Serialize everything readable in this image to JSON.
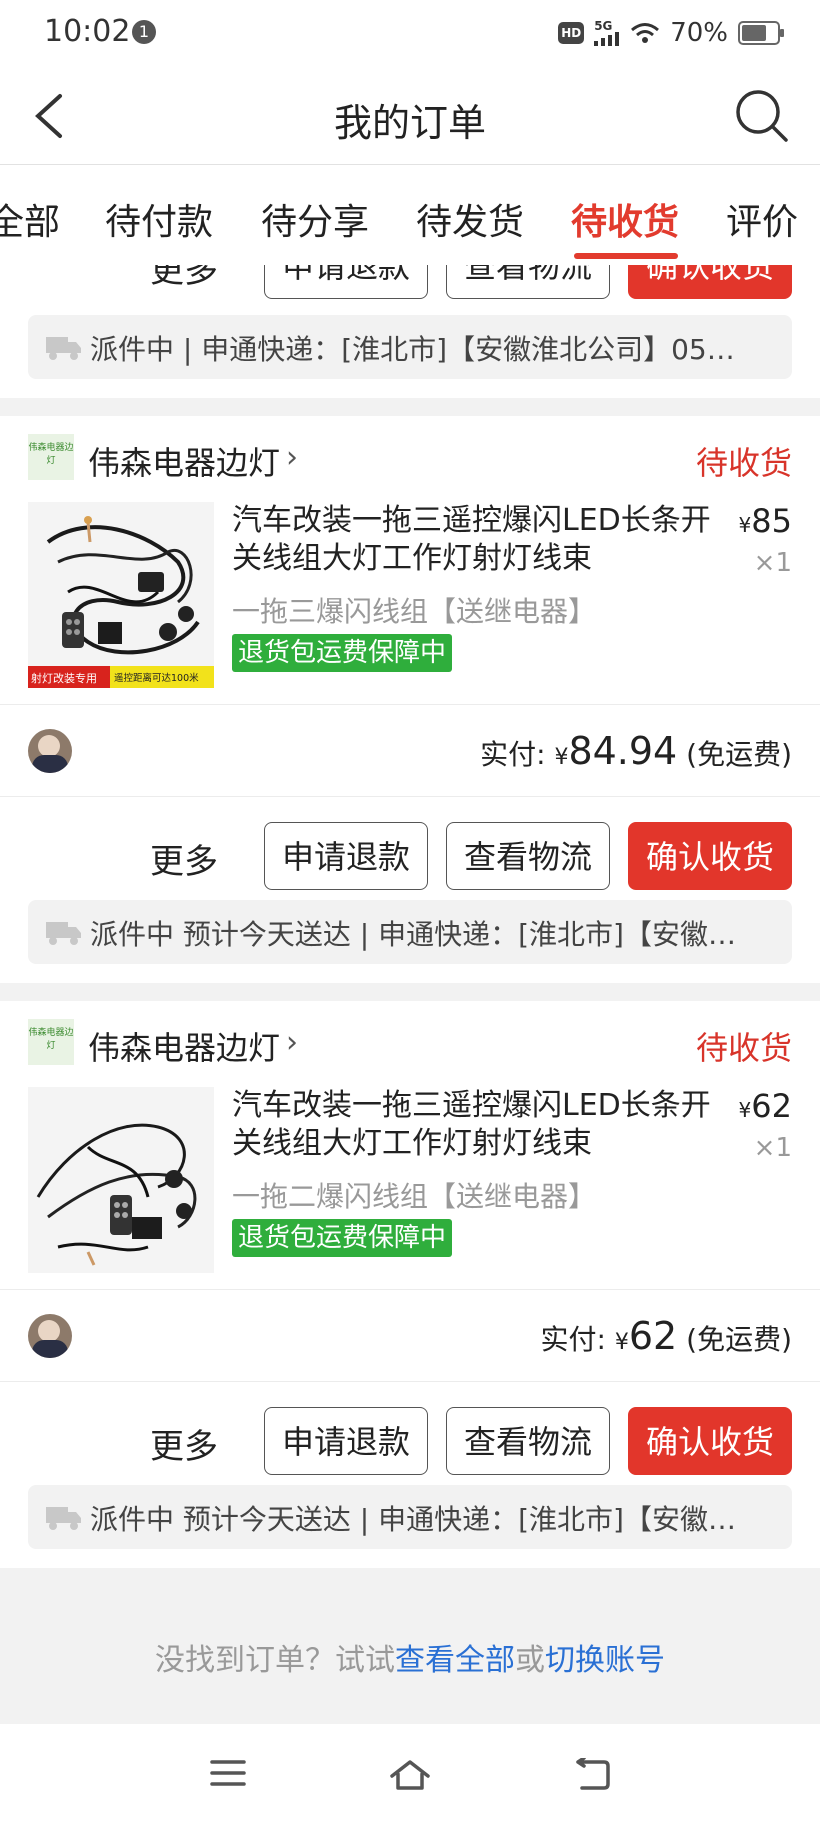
{
  "status_bar": {
    "time": "10:02",
    "notification_count": "1",
    "hd": "HD",
    "network": "5G",
    "battery": "70%"
  },
  "header": {
    "title": "我的订单"
  },
  "tabs": [
    "全部",
    "待付款",
    "待分享",
    "待发货",
    "待收货",
    "评价"
  ],
  "active_tab": "待收货",
  "partial_card": {
    "actions": {
      "more": "更多",
      "refund": "申请退款",
      "logistics": "查看物流",
      "confirm": "确认收货"
    },
    "logistics": "派件中 | 申通快递：[淮北市]【安徽淮北公司】05…"
  },
  "orders": [
    {
      "shop": {
        "logo_text": "伟森电器边灯",
        "name": "伟森电器边灯"
      },
      "status": "待收货",
      "product": {
        "title": "汽车改装一拖三遥控爆闪LED长条开关线组大灯工作灯射灯线束",
        "price_symbol": "¥",
        "price": "85",
        "qty": "×1",
        "sku": "一拖三爆闪线组【送继电器】",
        "badge": "退货包运费保障中",
        "image_caption_left": "射灯改装专用",
        "image_caption_right": "遥控距离可达100米"
      },
      "payment": {
        "label": "实付:",
        "symbol": "¥",
        "amount": "84.94",
        "note": "(免运费)"
      },
      "actions": {
        "more": "更多",
        "refund": "申请退款",
        "logistics": "查看物流",
        "confirm": "确认收货"
      },
      "logistics": "派件中 预计今天送达 | 申通快递：[淮北市]【安徽…"
    },
    {
      "shop": {
        "logo_text": "伟森电器边灯",
        "name": "伟森电器边灯"
      },
      "status": "待收货",
      "product": {
        "title": "汽车改装一拖三遥控爆闪LED长条开关线组大灯工作灯射灯线束",
        "price_symbol": "¥",
        "price": "62",
        "qty": "×1",
        "sku": "一拖二爆闪线组【送继电器】",
        "badge": "退货包运费保障中"
      },
      "payment": {
        "label": "实付:",
        "symbol": "¥",
        "amount": "62",
        "note": "(免运费)"
      },
      "actions": {
        "more": "更多",
        "refund": "申请退款",
        "logistics": "查看物流",
        "confirm": "确认收货"
      },
      "logistics": "派件中 预计今天送达 | 申通快递：[淮北市]【安徽…"
    }
  ],
  "empty_tip": {
    "prefix": "没找到订单？试试",
    "link1": "查看全部",
    "middle": "或",
    "link2": "切换账号"
  },
  "colors": {
    "accent": "#e23b2e",
    "badge_green": "#2fae3c",
    "link_blue": "#2a70d4"
  }
}
